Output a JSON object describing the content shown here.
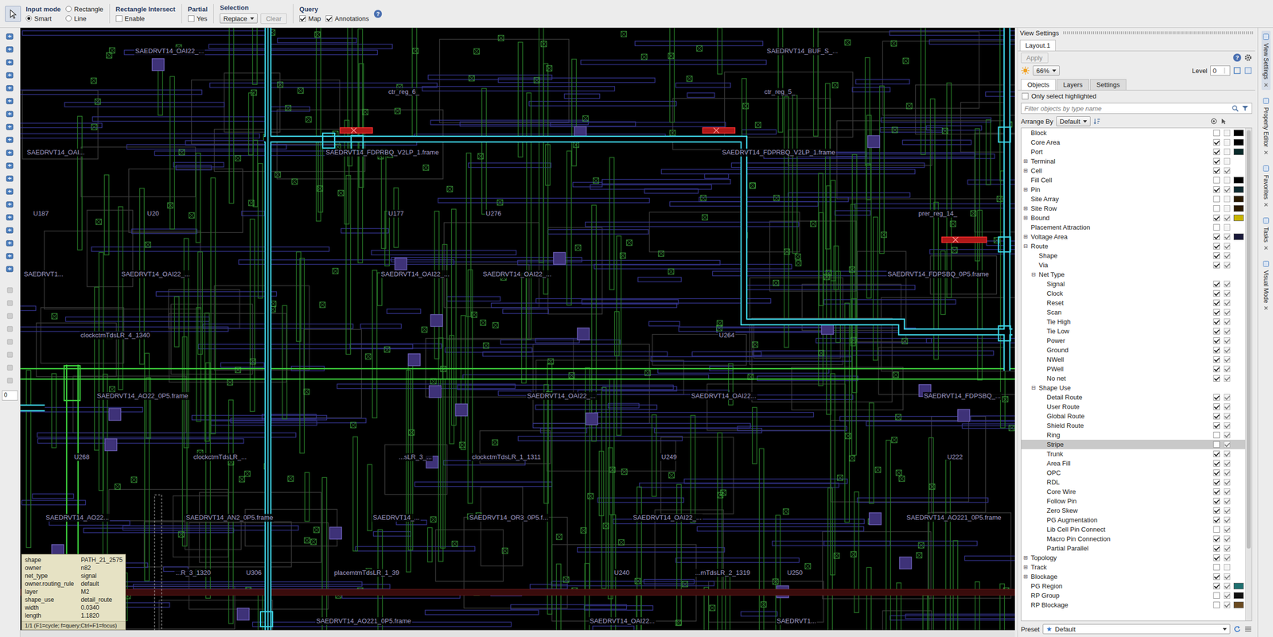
{
  "toolbar": {
    "input_mode": {
      "label": "Input mode",
      "options": [
        {
          "label": "Rectangle",
          "selected": false
        },
        {
          "label": "Smart",
          "selected": true
        },
        {
          "label": "Line",
          "selected": false
        }
      ]
    },
    "rectangle_intersect": {
      "label": "Rectangle Intersect",
      "option": {
        "label": "Enable",
        "checked": false
      }
    },
    "partial": {
      "label": "Partial",
      "option": {
        "label": "Yes",
        "checked": false
      }
    },
    "selection": {
      "label": "Selection",
      "value": "Replace",
      "clear": {
        "label": "Clear",
        "disabled": true
      }
    },
    "query": {
      "label": "Query",
      "options": [
        {
          "label": "Map",
          "checked": true
        },
        {
          "label": "Annotations",
          "checked": true
        }
      ]
    },
    "help": "?"
  },
  "left_toolbar": {
    "field": "0"
  },
  "canvas": {
    "labels": [
      "SAEDRVT14_OAI22_...",
      "ctr_reg_6_",
      "ctr_reg_5_",
      "SAEDRVT14_BUF_S_...",
      "SAEDRVT14_FDPRBQ_V2LP_1.frame",
      "SAEDRVT14_FDPRBQ_V2LP_1.frame",
      "SAEDRVT14_OAI...",
      "U187",
      "U20",
      "U177",
      "U276",
      "prer_reg_14_",
      "SAEDRVT1...",
      "SAEDRVT14_OAI22_...",
      "SAEDRVT14_OAI22_...",
      "SAEDRVT14_OAI22_...",
      "SAEDRVT14_FDPSBQ_0P5.frame",
      "clockctmTdsLR_4_1340",
      "U264",
      "SAEDRVT14_AO22_0P5.frame",
      "SAEDRVT14_OAI22_...",
      "SAEDRVT14_OAI22...",
      "SAEDRVT14_FDPSBQ_...",
      "U268",
      "clockctmTdsLR_...",
      "...sLR_3_...",
      "clockctmTdsLR_1_1311",
      "U249",
      "U222",
      "SAEDRVT14_AO22...",
      "SAEDRVT14_AN2_0P5.frame",
      "SAEDRVT14_...",
      "SAEDRVT14_OR3_0P5.f...",
      "SAEDRVT14_OAI22_...",
      "SAEDRVT14_AO221_0P5.frame",
      "...R_3_1320",
      "U306",
      "placemtmTdsLR_1_39",
      "U240",
      "...mTdsLR_2_1319",
      "U250",
      "SAEDRVT14_AO221_0P5.frame",
      "SAEDRVT14_OAI22...",
      "SAEDRVT1..."
    ],
    "query_popup": {
      "rows": [
        {
          "key": "shape",
          "value": "PATH_21_2575"
        },
        {
          "key": "owner",
          "value": "n82"
        },
        {
          "key": "net_type",
          "value": "signal"
        },
        {
          "key": "owner.routing_rule",
          "value": "default"
        },
        {
          "key": "layer",
          "value": "M2"
        },
        {
          "key": "shape_use",
          "value": "detail_route"
        },
        {
          "key": "width",
          "value": "0.0340"
        },
        {
          "key": "length",
          "value": "1.1820"
        }
      ],
      "footer": "1/1 (F1=cycle; f=query;Ctrl+F1=focus)"
    }
  },
  "view_settings": {
    "title": "View Settings",
    "layout_tab": "Layout.1",
    "apply": {
      "label": "Apply",
      "disabled": true
    },
    "zoom": "66%",
    "level": {
      "label": "Level",
      "value": "0"
    },
    "tabs": [
      {
        "label": "Objects",
        "selected": true
      },
      {
        "label": "Layers",
        "selected": false
      },
      {
        "label": "Settings",
        "selected": false
      }
    ],
    "only_select_highlighted": {
      "label": "Only select highlighted",
      "checked": false
    },
    "filter": {
      "placeholder": "Filter objects by type name"
    },
    "arrange_by": {
      "label": "Arrange By",
      "value": "Default"
    },
    "tree": [
      {
        "label": "Block",
        "depth": 0,
        "expander": "",
        "visible": false,
        "selectable": false,
        "color": "#000000",
        "selected": false
      },
      {
        "label": "Core Area",
        "depth": 0,
        "expander": "",
        "visible": true,
        "selectable": false,
        "color": "#000000",
        "selected": false
      },
      {
        "label": "Port",
        "depth": 0,
        "expander": "",
        "visible": true,
        "selectable": false,
        "color": "#0a2a2a",
        "selected": false
      },
      {
        "label": "Terminal",
        "depth": 0,
        "expander": "⊞",
        "visible": true,
        "selectable": false,
        "color": null,
        "selected": false
      },
      {
        "label": "Cell",
        "depth": 0,
        "expander": "⊞",
        "visible": true,
        "selectable": true,
        "color": null,
        "selected": false
      },
      {
        "label": "Fill Cell",
        "depth": 0,
        "expander": "",
        "visible": false,
        "selectable": false,
        "color": "#000000",
        "selected": false
      },
      {
        "label": "Pin",
        "depth": 0,
        "expander": "⊞",
        "visible": true,
        "selectable": true,
        "color": "#0e2a30",
        "selected": false
      },
      {
        "label": "Site Array",
        "depth": 0,
        "expander": "",
        "visible": false,
        "selectable": false,
        "color": "#2a1a00",
        "selected": false
      },
      {
        "label": "Site Row",
        "depth": 0,
        "expander": "⊞",
        "visible": false,
        "selectable": false,
        "color": "#2a1a00",
        "selected": false
      },
      {
        "label": "Bound",
        "depth": 0,
        "expander": "⊞",
        "visible": true,
        "selectable": true,
        "color": "#c8b400",
        "selected": false
      },
      {
        "label": "Placement Attraction",
        "depth": 0,
        "expander": "",
        "visible": false,
        "selectable": false,
        "color": null,
        "selected": false
      },
      {
        "label": "Voltage Area",
        "depth": 0,
        "expander": "⊞",
        "visible": true,
        "selectable": true,
        "color": "#1a1a3a",
        "selected": false
      },
      {
        "label": "Route",
        "depth": 0,
        "expander": "⊟",
        "visible": true,
        "selectable": true,
        "color": null,
        "selected": false
      },
      {
        "label": "Shape",
        "depth": 1,
        "expander": "",
        "visible": true,
        "selectable": true,
        "color": null,
        "selected": false
      },
      {
        "label": "Via",
        "depth": 1,
        "expander": "",
        "visible": true,
        "selectable": true,
        "color": null,
        "selected": false
      },
      {
        "label": "Net Type",
        "depth": 1,
        "expander": "⊟",
        "visible": null,
        "selectable": null,
        "color": null,
        "selected": false
      },
      {
        "label": "Signal",
        "depth": 2,
        "expander": "",
        "visible": true,
        "selectable": true,
        "color": null,
        "selected": false
      },
      {
        "label": "Clock",
        "depth": 2,
        "expander": "",
        "visible": true,
        "selectable": true,
        "color": null,
        "selected": false
      },
      {
        "label": "Reset",
        "depth": 2,
        "expander": "",
        "visible": true,
        "selectable": true,
        "color": null,
        "selected": false
      },
      {
        "label": "Scan",
        "depth": 2,
        "expander": "",
        "visible": true,
        "selectable": true,
        "color": null,
        "selected": false
      },
      {
        "label": "Tie High",
        "depth": 2,
        "expander": "",
        "visible": true,
        "selectable": true,
        "color": null,
        "selected": false
      },
      {
        "label": "Tie Low",
        "depth": 2,
        "expander": "",
        "visible": true,
        "selectable": true,
        "color": null,
        "selected": false
      },
      {
        "label": "Power",
        "depth": 2,
        "expander": "",
        "visible": true,
        "selectable": true,
        "color": null,
        "selected": false
      },
      {
        "label": "Ground",
        "depth": 2,
        "expander": "",
        "visible": true,
        "selectable": true,
        "color": null,
        "selected": false
      },
      {
        "label": "NWell",
        "depth": 2,
        "expander": "",
        "visible": true,
        "selectable": true,
        "color": null,
        "selected": false
      },
      {
        "label": "PWell",
        "depth": 2,
        "expander": "",
        "visible": true,
        "selectable": true,
        "color": null,
        "selected": false
      },
      {
        "label": "No net",
        "depth": 2,
        "expander": "",
        "visible": true,
        "selectable": true,
        "color": null,
        "selected": false
      },
      {
        "label": "Shape Use",
        "depth": 1,
        "expander": "⊟",
        "visible": null,
        "selectable": null,
        "color": null,
        "selected": false
      },
      {
        "label": "Detail Route",
        "depth": 2,
        "expander": "",
        "visible": true,
        "selectable": true,
        "color": null,
        "selected": false
      },
      {
        "label": "User Route",
        "depth": 2,
        "expander": "",
        "visible": true,
        "selectable": true,
        "color": null,
        "selected": false
      },
      {
        "label": "Global Route",
        "depth": 2,
        "expander": "",
        "visible": true,
        "selectable": true,
        "color": null,
        "selected": false
      },
      {
        "label": "Shield Route",
        "depth": 2,
        "expander": "",
        "visible": true,
        "selectable": true,
        "color": null,
        "selected": false
      },
      {
        "label": "Ring",
        "depth": 2,
        "expander": "",
        "visible": false,
        "selectable": true,
        "color": null,
        "selected": false
      },
      {
        "label": "Stripe",
        "depth": 2,
        "expander": "",
        "visible": false,
        "selectable": true,
        "color": null,
        "selected": true
      },
      {
        "label": "Trunk",
        "depth": 2,
        "expander": "",
        "visible": true,
        "selectable": true,
        "color": null,
        "selected": false
      },
      {
        "label": "Area Fill",
        "depth": 2,
        "expander": "",
        "visible": true,
        "selectable": true,
        "color": null,
        "selected": false
      },
      {
        "label": "OPC",
        "depth": 2,
        "expander": "",
        "visible": true,
        "selectable": true,
        "color": null,
        "selected": false
      },
      {
        "label": "RDL",
        "depth": 2,
        "expander": "",
        "visible": true,
        "selectable": true,
        "color": null,
        "selected": false
      },
      {
        "label": "Core Wire",
        "depth": 2,
        "expander": "",
        "visible": true,
        "selectable": true,
        "color": null,
        "selected": false
      },
      {
        "label": "Follow Pin",
        "depth": 2,
        "expander": "",
        "visible": true,
        "selectable": true,
        "color": null,
        "selected": false
      },
      {
        "label": "Zero Skew",
        "depth": 2,
        "expander": "",
        "visible": true,
        "selectable": true,
        "color": null,
        "selected": false
      },
      {
        "label": "PG Augmentation",
        "depth": 2,
        "expander": "",
        "visible": true,
        "selectable": true,
        "color": null,
        "selected": false
      },
      {
        "label": "Lib Cell Pin Connect",
        "depth": 2,
        "expander": "",
        "visible": false,
        "selectable": true,
        "color": null,
        "selected": false
      },
      {
        "label": "Macro Pin Connection",
        "depth": 2,
        "expander": "",
        "visible": true,
        "selectable": true,
        "color": null,
        "selected": false
      },
      {
        "label": "Partial Parallel",
        "depth": 2,
        "expander": "",
        "visible": true,
        "selectable": true,
        "color": null,
        "selected": false
      },
      {
        "label": "Topology",
        "depth": 0,
        "expander": "⊞",
        "visible": true,
        "selectable": true,
        "color": null,
        "selected": false
      },
      {
        "label": "Track",
        "depth": 0,
        "expander": "⊞",
        "visible": false,
        "selectable": false,
        "color": null,
        "selected": false
      },
      {
        "label": "Blockage",
        "depth": 0,
        "expander": "⊞",
        "visible": true,
        "selectable": true,
        "color": null,
        "selected": false
      },
      {
        "label": "PG Region",
        "depth": 0,
        "expander": "",
        "visible": true,
        "selectable": true,
        "color": "#1f6f6f",
        "selected": false
      },
      {
        "label": "RP Group",
        "depth": 0,
        "expander": "",
        "visible": false,
        "selectable": true,
        "color": "#101010",
        "selected": false
      },
      {
        "label": "RP Blockage",
        "depth": 0,
        "expander": "",
        "visible": false,
        "selectable": true,
        "color": "#6a4a20",
        "selected": false
      }
    ],
    "preset": {
      "label": "Preset",
      "value": "Default"
    }
  },
  "side_tabs": [
    {
      "label": "View Settings",
      "selected": true
    },
    {
      "label": "Property Editor",
      "selected": false
    },
    {
      "label": "Favorites",
      "selected": false
    },
    {
      "label": "Tasks",
      "selected": false
    },
    {
      "label": "Visual Mode",
      "selected": false
    }
  ]
}
